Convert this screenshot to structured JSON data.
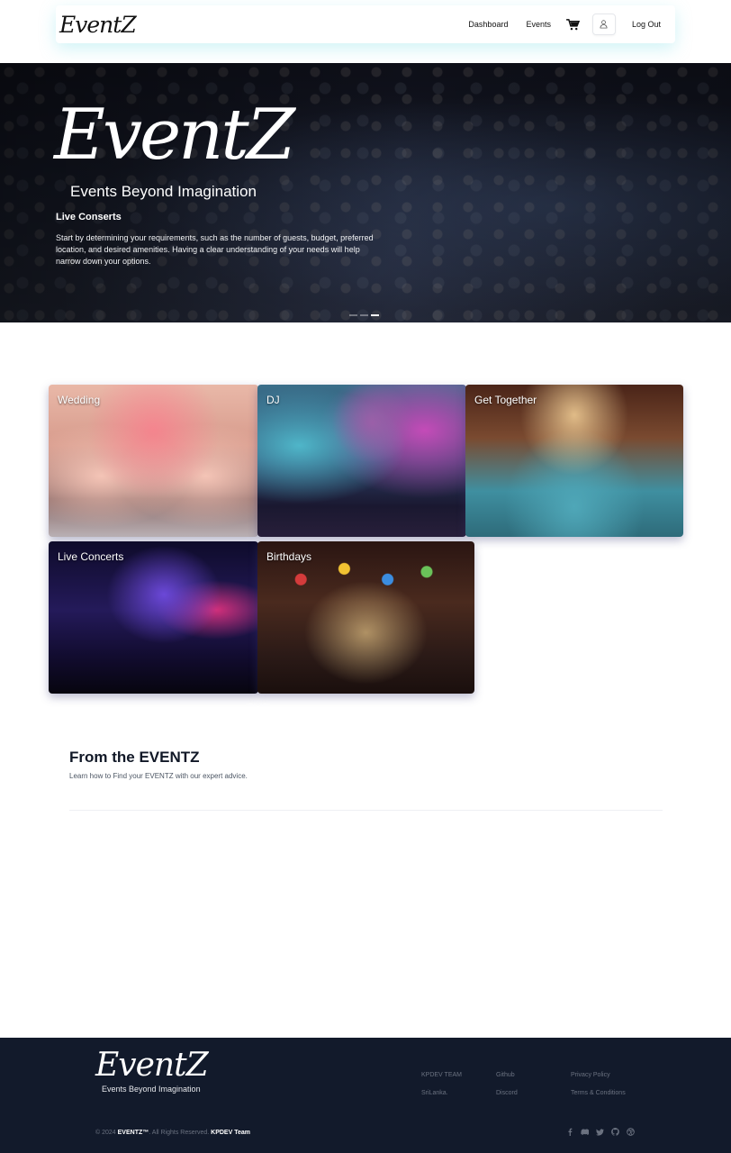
{
  "nav": {
    "logo": "EventZ",
    "links": [
      "Dashboard",
      "Events"
    ],
    "logout": "Log Out"
  },
  "hero": {
    "logo": "EventZ",
    "tagline": "Events Beyond Imagination",
    "title": "Live Conserts",
    "description": "Start by determining your requirements, such as the number of guests, budget, preferred location, and desired amenities. Having a clear understanding of your needs will help narrow down your options.",
    "slides": 3,
    "active_slide": 3
  },
  "categories": [
    {
      "label": "Wedding"
    },
    {
      "label": "DJ"
    },
    {
      "label": "Get Together"
    },
    {
      "label": "Live Concerts"
    },
    {
      "label": "Birthdays"
    }
  ],
  "section": {
    "title": "From the EVENTZ",
    "subtitle": "Learn how to Find your EVENTZ with our expert advice."
  },
  "footer": {
    "logo": "EventZ",
    "tagline": "Events Beyond Imagination",
    "col1": [
      "KPDEV TEAM",
      "SriLanka."
    ],
    "col2": [
      "Github",
      "Discord"
    ],
    "col3": [
      "Privacy Policy",
      "Terms & Conditions"
    ],
    "copyright_prefix": "© 2024",
    "brand": "EVENTZ™",
    "rights": ". All Rights Reserved.",
    "team": "KPDEV Team",
    "socials": [
      "facebook-icon",
      "discord-icon",
      "twitter-icon",
      "github-icon",
      "dribbble-icon"
    ]
  }
}
